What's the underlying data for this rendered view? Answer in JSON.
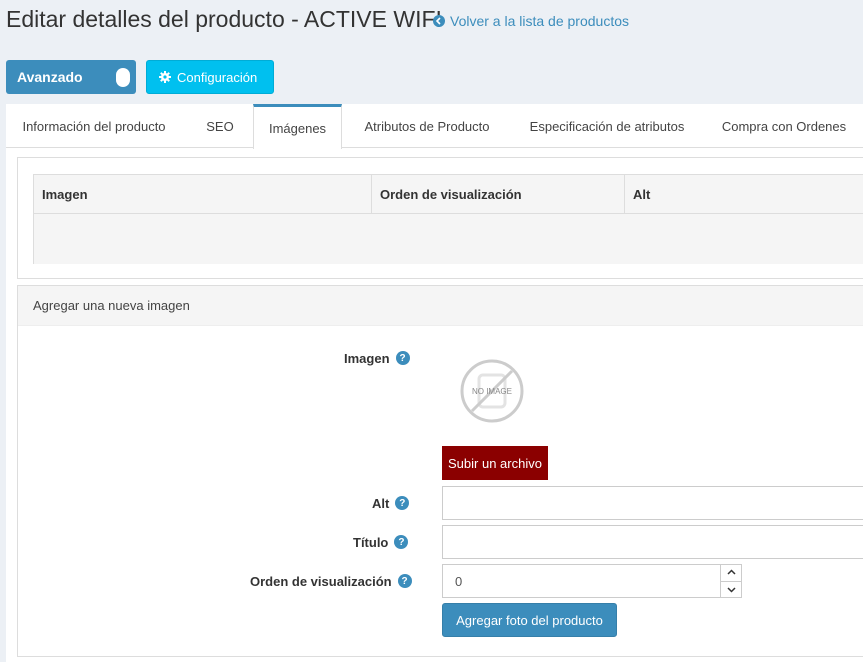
{
  "header": {
    "title": "Editar detalles del producto - ACTIVE WIFI",
    "back_link": "Volver a la lista de productos"
  },
  "toolbar": {
    "advanced_label": "Avanzado",
    "config_label": "Configuración"
  },
  "tabs": [
    {
      "label": "Información del producto"
    },
    {
      "label": "SEO"
    },
    {
      "label": "Imágenes"
    },
    {
      "label": "Atributos de Producto"
    },
    {
      "label": "Especificación de atributos"
    },
    {
      "label": "Compra con Ordenes"
    }
  ],
  "active_tab": "Imágenes",
  "images_grid": {
    "columns": [
      "Imagen",
      "Orden de visualización",
      "Alt"
    ],
    "rows": []
  },
  "add_image": {
    "panel_title": "Agregar una nueva imagen",
    "image_label": "Imagen",
    "no_image_text": "NO IMAGE",
    "upload_label": "Subir un archivo",
    "alt_label": "Alt",
    "alt_value": "",
    "title_label": "Título",
    "title_value": "",
    "order_label": "Orden de visualización",
    "order_value": "0",
    "submit_label": "Agregar foto del producto"
  },
  "colors": {
    "primary": "#3c8dbc",
    "info": "#00c0ef",
    "upload": "#8b0000",
    "background": "#ecf0f5"
  }
}
